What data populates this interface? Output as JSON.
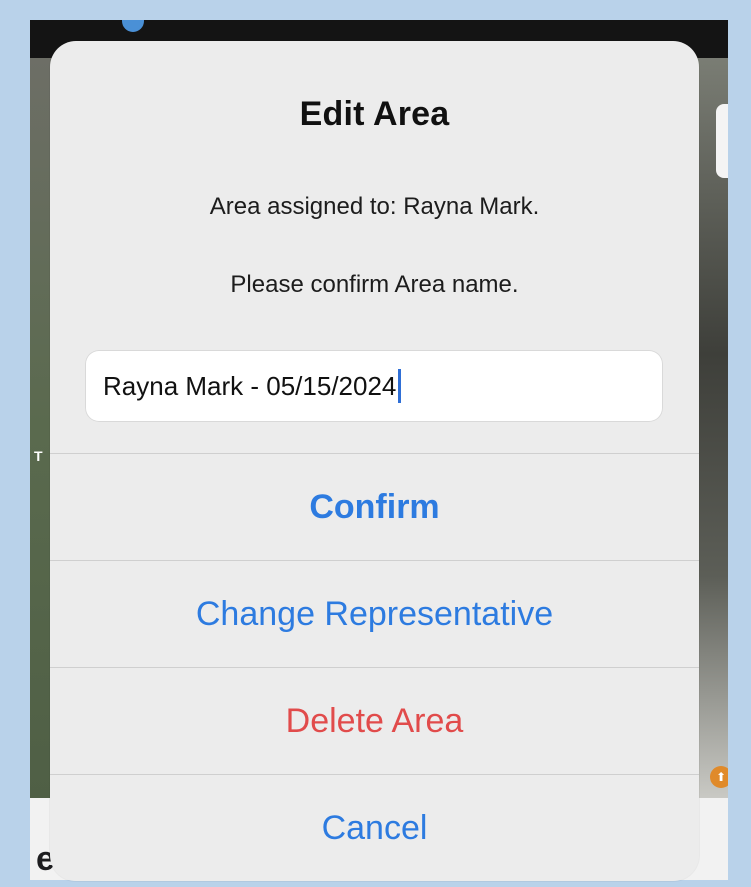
{
  "background": {
    "map_label": "T",
    "bottom_sheet_glyph": "e"
  },
  "dialog": {
    "title": "Edit Area",
    "message_assigned": "Area assigned to: Rayna Mark.",
    "message_confirm": "Please confirm Area name.",
    "area_name_value": "Rayna Mark - 05/15/2024",
    "actions": {
      "confirm": "Confirm",
      "change_representative": "Change Representative",
      "delete_area": "Delete Area",
      "cancel": "Cancel"
    }
  },
  "colors": {
    "outer_background": "#b9d2ea",
    "dialog_background": "#ececec",
    "action_blue": "#2d7be0",
    "destructive_red": "#e14b4b",
    "caret_blue": "#2f6fd6"
  }
}
